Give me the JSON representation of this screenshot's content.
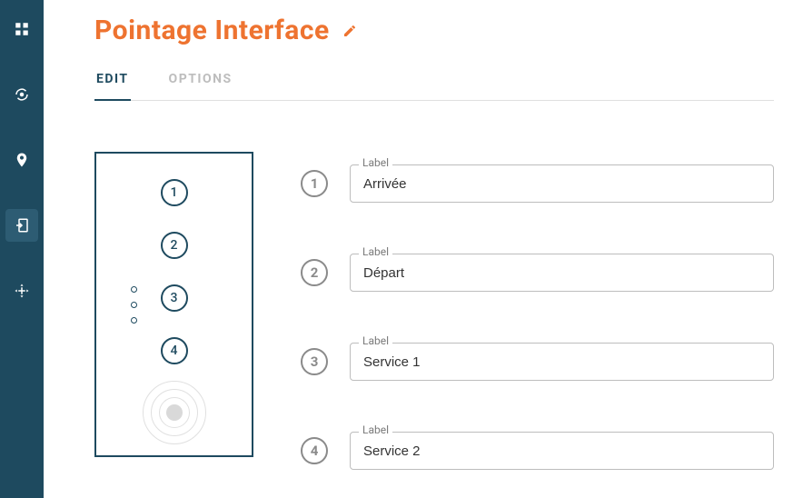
{
  "title": "Pointage Interface",
  "tabs": {
    "edit": "EDIT",
    "options": "OPTIONS"
  },
  "device": {
    "b1": "1",
    "b2": "2",
    "b3": "3",
    "b4": "4"
  },
  "legend": "Label",
  "rows": [
    {
      "num": "1",
      "value": "Arrivée"
    },
    {
      "num": "2",
      "value": "Départ"
    },
    {
      "num": "3",
      "value": "Service 1"
    },
    {
      "num": "4",
      "value": "Service 2"
    }
  ]
}
